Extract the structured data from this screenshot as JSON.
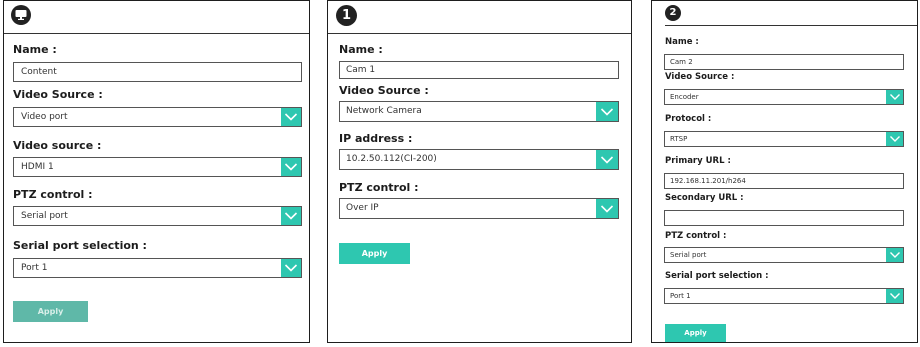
{
  "colors": {
    "accent": "#2ec7b0",
    "apply_disabled": "#5fb8a8",
    "border": "#1e1e1e"
  },
  "panel1": {
    "icon": "monitor-icon",
    "name_label": "Name :",
    "name_value": "Content",
    "video_source_label": "Video Source :",
    "video_source_value": "Video port",
    "video_source2_label": "Video source :",
    "video_source2_value": "HDMI 1",
    "ptz_label": "PTZ control :",
    "ptz_value": "Serial port",
    "serial_label": "Serial port selection :",
    "serial_value": "Port 1",
    "apply_label": "Apply"
  },
  "panel2": {
    "badge": "1",
    "name_label": "Name :",
    "name_value": "Cam 1",
    "video_source_label": "Video Source :",
    "video_source_value": "Network Camera",
    "ip_label": "IP address :",
    "ip_value": "10.2.50.112(CI-200)",
    "ptz_label": "PTZ control :",
    "ptz_value": "Over IP",
    "apply_label": "Apply"
  },
  "panel3": {
    "badge": "2",
    "name_label": "Name :",
    "name_value": "Cam 2",
    "video_source_label": "Video Source :",
    "video_source_value": "Encoder",
    "protocol_label": "Protocol :",
    "protocol_value": "RTSP",
    "primary_url_label": "Primary URL :",
    "primary_url_value": "192.168.11.201/h264",
    "secondary_url_label": "Secondary URL :",
    "secondary_url_value": "",
    "ptz_label": "PTZ control :",
    "ptz_value": "Serial port",
    "serial_label": "Serial port selection :",
    "serial_value": "Port 1",
    "apply_label": "Apply"
  }
}
